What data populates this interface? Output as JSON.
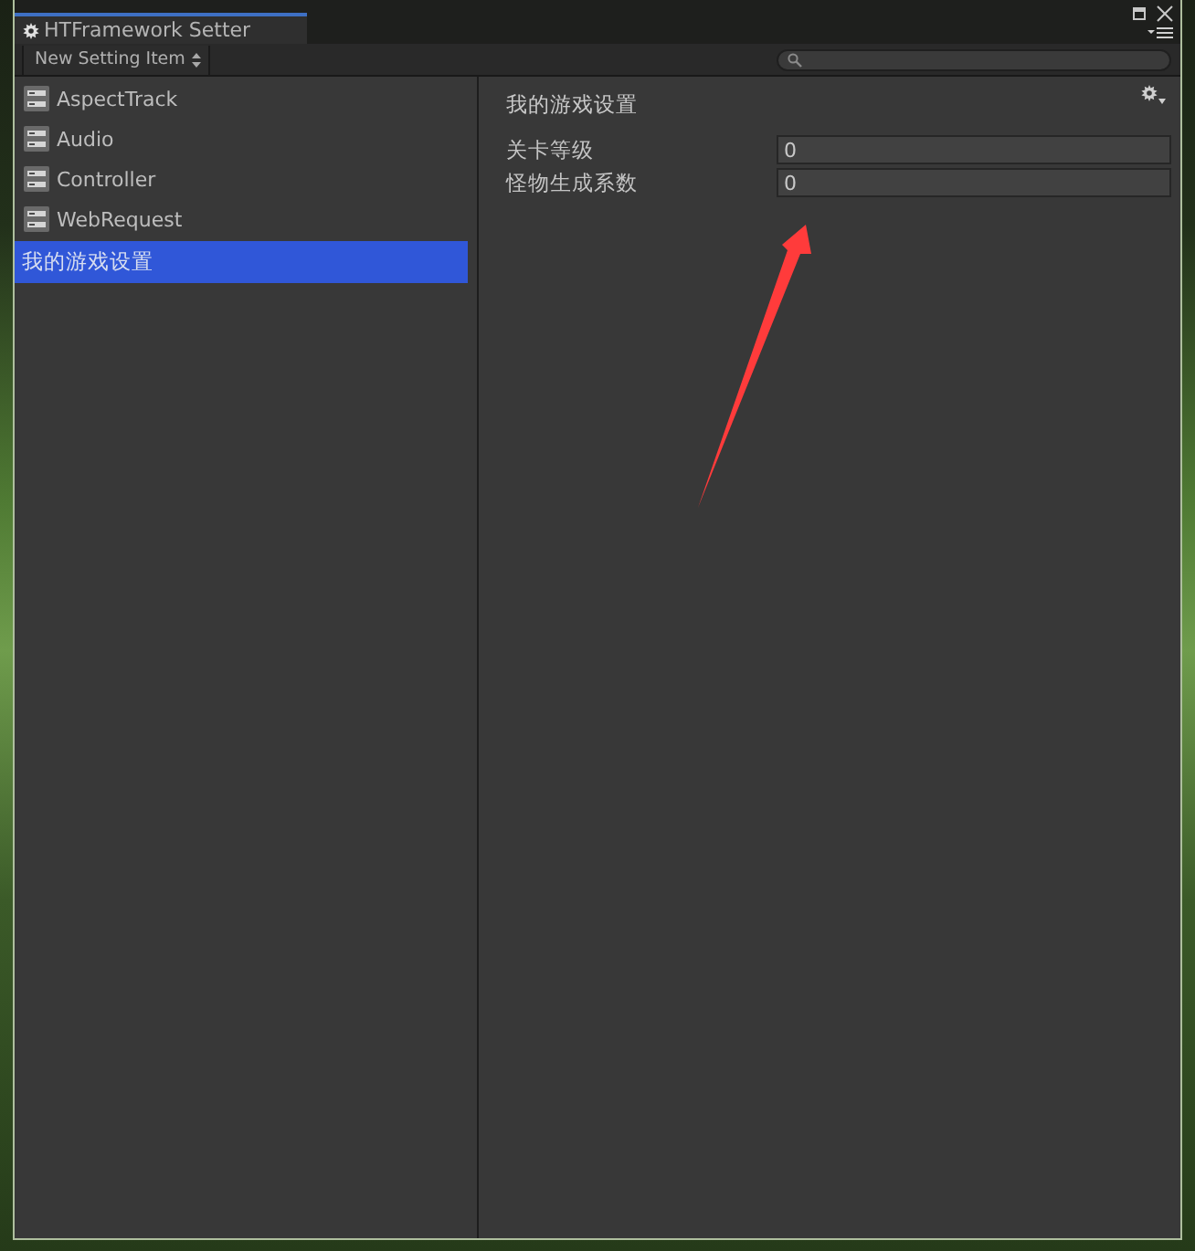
{
  "window": {
    "tab_title": "HTFramework Setter"
  },
  "toolbar": {
    "dropdown": "New Setting Item"
  },
  "sidebar": {
    "items": [
      {
        "label": "AspectTrack",
        "kind": "module",
        "selected": false
      },
      {
        "label": "Audio",
        "kind": "module",
        "selected": false
      },
      {
        "label": "Controller",
        "kind": "module",
        "selected": false
      },
      {
        "label": "WebRequest",
        "kind": "module",
        "selected": false
      },
      {
        "label": "我的游戏设置",
        "kind": "custom",
        "selected": true
      }
    ]
  },
  "panel": {
    "title": "我的游戏设置",
    "fields": [
      {
        "label": "关卡等级",
        "value": "0"
      },
      {
        "label": "怪物生成系数",
        "value": "0"
      }
    ]
  },
  "annotations": [
    {
      "kind": "arrow"
    }
  ]
}
